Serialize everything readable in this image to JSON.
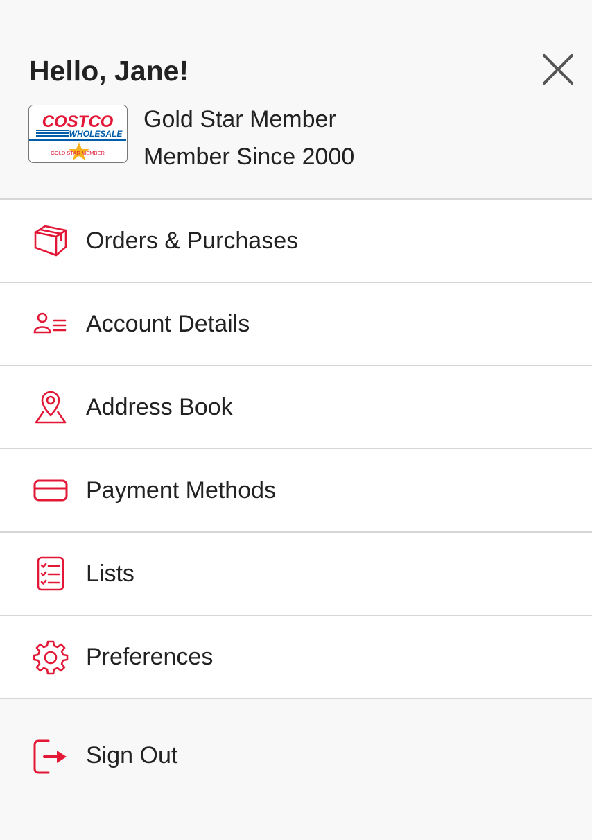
{
  "header": {
    "greeting": "Hello, Jane!",
    "member_tier": "Gold Star Member",
    "member_since": "Member Since 2000",
    "card": {
      "brand_top": "COSTCO",
      "brand_bottom": "WHOLESALE",
      "tier_text": "GOLD STAR MEMBER"
    }
  },
  "menu": {
    "items": [
      {
        "label": "Orders & Purchases",
        "icon": "box-icon"
      },
      {
        "label": "Account Details",
        "icon": "user-list-icon"
      },
      {
        "label": "Address Book",
        "icon": "map-pin-icon"
      },
      {
        "label": "Payment Methods",
        "icon": "credit-card-icon"
      },
      {
        "label": "Lists",
        "icon": "checklist-icon"
      },
      {
        "label": "Preferences",
        "icon": "gear-icon"
      }
    ]
  },
  "signout": {
    "label": "Sign Out",
    "icon": "sign-out-icon"
  },
  "colors": {
    "accent": "#e31837",
    "brand_blue": "#005daa",
    "gold": "#f5b21b",
    "text": "#222222",
    "divider": "#d6d6d6",
    "background": "#f8f8f8"
  }
}
